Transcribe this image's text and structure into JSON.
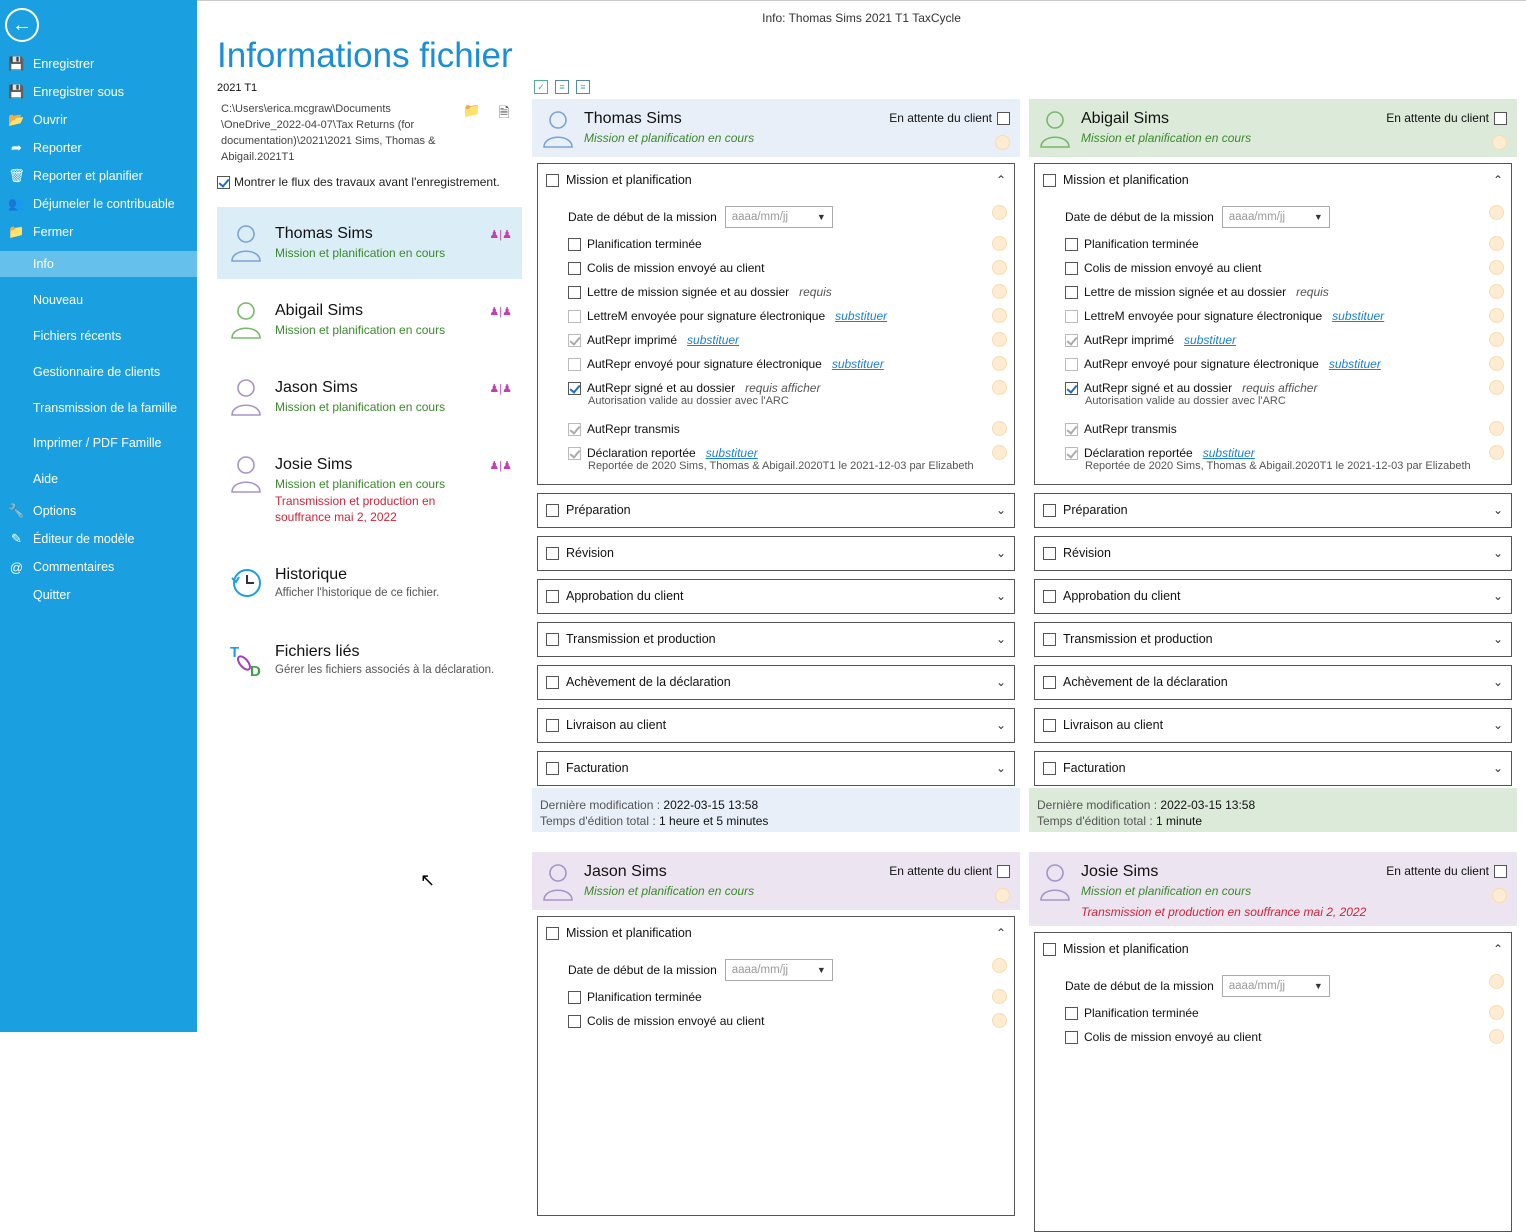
{
  "window_title": "Info: Thomas Sims 2021 T1 TaxCycle",
  "colors": {
    "sidebar": "#1a9fe0",
    "accent": "#1a8fd6",
    "status_green": "#3a8a2c",
    "alert_red": "#d2233a"
  },
  "sidebar": {
    "back_icon": "arrow-left-icon",
    "items": [
      {
        "label": "Enregistrer",
        "icon": "save-icon"
      },
      {
        "label": "Enregistrer sous",
        "icon": "save-as-icon"
      },
      {
        "label": "Ouvrir",
        "icon": "folder-open-icon"
      },
      {
        "label": "Reporter",
        "icon": "carry-forward-icon"
      },
      {
        "label": "Reporter et planifier",
        "icon": "carry-plan-icon"
      },
      {
        "label": "Déjumeler le contribuable",
        "icon": "unlink-people-icon"
      },
      {
        "label": "Fermer",
        "icon": "folder-close-icon"
      },
      {
        "label": "Info",
        "icon": ""
      },
      {
        "label": "Nouveau",
        "icon": ""
      },
      {
        "label": "Fichiers récents",
        "icon": ""
      },
      {
        "label": "Gestionnaire de clients",
        "icon": ""
      },
      {
        "label": "Transmission de la famille",
        "icon": ""
      },
      {
        "label": "Imprimer / PDF Famille",
        "icon": ""
      },
      {
        "label": "Aide",
        "icon": ""
      },
      {
        "label": "Options",
        "icon": "wrench-icon"
      },
      {
        "label": "Éditeur de modèle",
        "icon": "edit-icon"
      },
      {
        "label": "Commentaires",
        "icon": "at-icon"
      },
      {
        "label": "Quitter",
        "icon": ""
      }
    ]
  },
  "main": {
    "title": "Informations fichier",
    "year": "2021 T1",
    "path": "C:\\Users\\erica.mcgraw\\Documents \\OneDrive_2022-04-07\\Tax Returns (for documentation)\\2021\\2021 Sims, Thomas & Abigail.2021T1",
    "show_workflow": "Montrer le flux des travaux avant l'enregistrement.",
    "people": [
      {
        "name": "Thomas Sims",
        "status": "Mission et planification en cours",
        "alert": ""
      },
      {
        "name": "Abigail Sims",
        "status": "Mission et planification en cours",
        "alert": ""
      },
      {
        "name": "Jason Sims",
        "status": "Mission et planification en cours",
        "alert": ""
      },
      {
        "name": "Josie Sims",
        "status": "Mission et planification en cours",
        "alert": "Transmission et production en souffrance  mai 2, 2022"
      }
    ],
    "history": {
      "title": "Historique",
      "desc": "Afficher l'historique de ce fichier."
    },
    "linked": {
      "title": "Fichiers liés",
      "desc": "Gérer les fichiers associés à la déclaration."
    }
  },
  "workflow": {
    "waiting_label": "En attente du client",
    "mission_title": "Mission et planification",
    "start_date_label": "Date de début de la mission",
    "date_placeholder": "aaaa/mm/jj",
    "items": [
      {
        "label": "Planification terminée",
        "checked": false,
        "tag": "",
        "link": "",
        "sub": ""
      },
      {
        "label": "Colis de mission envoyé au client",
        "checked": false,
        "tag": "",
        "link": "",
        "sub": ""
      },
      {
        "label": "Lettre de mission signée et au dossier",
        "checked": false,
        "tag": "requis",
        "link": "",
        "sub": ""
      },
      {
        "label": "LettreM envoyée pour signature électronique",
        "checked": false,
        "tag": "",
        "link": "substituer",
        "sub": ""
      },
      {
        "label": "AutRepr imprimé",
        "checked": true,
        "tag": "",
        "link": "substituer",
        "sub": ""
      },
      {
        "label": "AutRepr envoyé pour signature électronique",
        "checked": false,
        "tag": "",
        "link": "substituer",
        "sub": ""
      },
      {
        "label": "AutRepr signé et au dossier",
        "checked": true,
        "tag": "requis afficher",
        "link": "",
        "sub": "Autorisation valide au dossier avec l'ARC"
      },
      {
        "label": "AutRepr transmis",
        "checked": true,
        "tag": "",
        "link": "",
        "sub": ""
      },
      {
        "label": "Déclaration reportée",
        "checked": true,
        "tag": "",
        "link": "substituer",
        "sub": "Reportée de 2020 Sims, Thomas & Abigail.2020T1 le 2021-12-03 par Elizabeth"
      }
    ],
    "sections": [
      "Préparation",
      "Révision",
      "Approbation du client",
      "Transmission et production",
      "Achèvement de la déclaration",
      "Livraison au client",
      "Facturation"
    ],
    "cards": [
      {
        "name": "Thomas Sims",
        "status": "Mission et planification en cours",
        "alert": "",
        "last_mod_label": "Dernière modification :",
        "last_mod": "2022-03-15 13:58",
        "edit_label": "Temps d'édition total :",
        "edit_time": "1 heure et 5 minutes"
      },
      {
        "name": "Abigail Sims",
        "status": "Mission et planification en cours",
        "alert": "",
        "last_mod_label": "Dernière modification :",
        "last_mod": "2022-03-15 13:58",
        "edit_label": "Temps d'édition total :",
        "edit_time": "1 minute"
      },
      {
        "name": "Jason Sims",
        "status": "Mission et planification en cours",
        "alert": ""
      },
      {
        "name": "Josie Sims",
        "status": "Mission et planification en cours",
        "alert": "Transmission et production en souffrance  mai 2, 2022"
      }
    ]
  }
}
